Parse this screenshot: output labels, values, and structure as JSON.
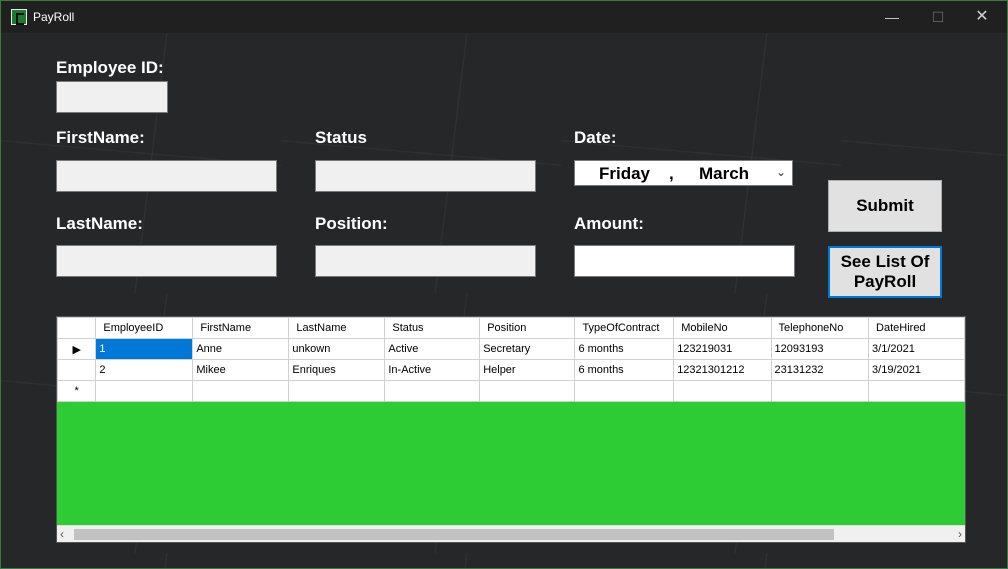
{
  "window": {
    "title": "PayRoll"
  },
  "titlebar": {
    "minimize": "—",
    "maximize": "☐",
    "close": "✕"
  },
  "form": {
    "employee_id_label": "Employee ID:",
    "firstname_label": "FirstName:",
    "status_label": "Status",
    "date_label": "Date:",
    "lastname_label": "LastName:",
    "position_label": "Position:",
    "amount_label": "Amount:",
    "employee_id_value": "",
    "firstname_value": "",
    "status_value": "",
    "lastname_value": "",
    "position_value": "",
    "amount_value": "",
    "date_day": "Friday",
    "date_sep": ",",
    "date_month": "March",
    "date_chevron": "⌄",
    "submit_label": "Submit",
    "see_list_label_1": "See List Of",
    "see_list_label_2": "PayRoll"
  },
  "grid": {
    "columns": [
      "EmployeeID",
      "FirstName",
      "LastName",
      "Status",
      "Position",
      "TypeOfContract",
      "MobileNo",
      "TelephoneNo",
      "DateHired"
    ],
    "rows": [
      [
        "1",
        "Anne",
        "unkown",
        "Active",
        "Secretary",
        "6 months",
        "123219031",
        "12093193",
        "3/1/2021"
      ],
      [
        "2",
        "Mikee",
        "Enriques",
        "In-Active",
        "Helper",
        "6 months",
        "12321301212",
        "23131232",
        "3/19/2021"
      ]
    ],
    "current_row_marker": "▶",
    "new_row_marker": "*",
    "scroll_left": "‹",
    "scroll_right": "›"
  },
  "colors": {
    "accent": "#0078d7",
    "grid_background": "#2ecc34",
    "window_background": "#262729"
  }
}
